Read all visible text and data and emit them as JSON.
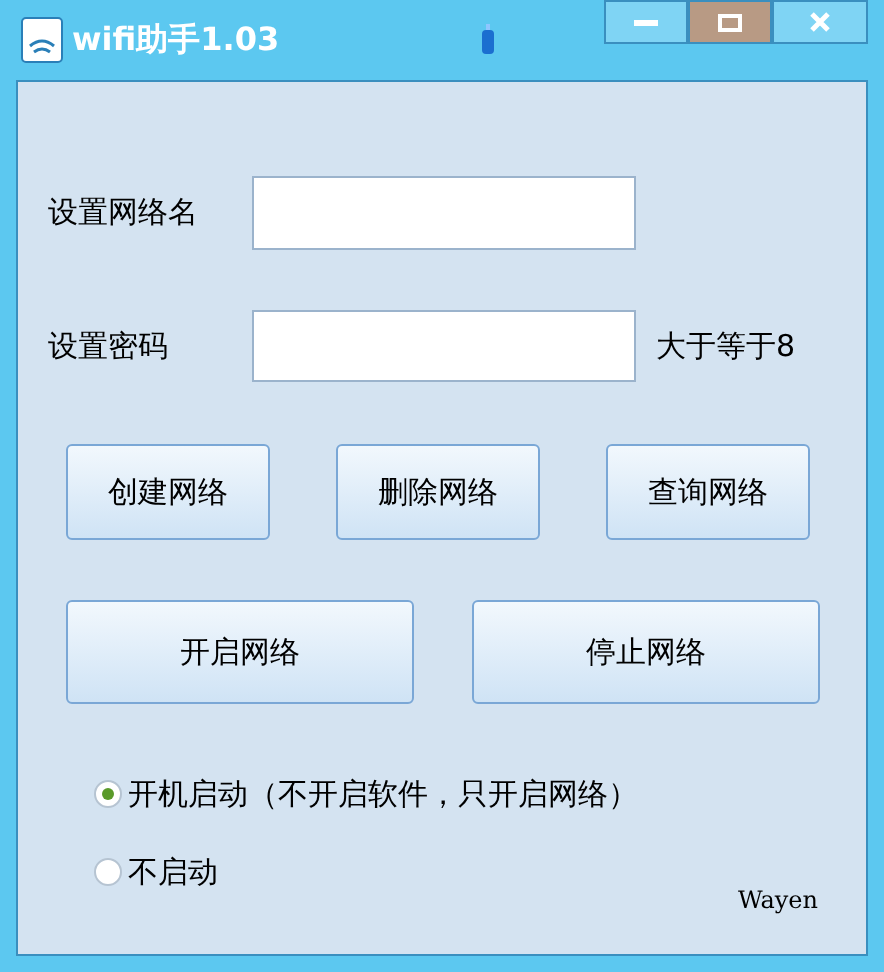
{
  "window": {
    "title": "wifi助手1.03"
  },
  "fields": [
    {
      "label": "设置网络名"
    },
    {
      "label": "设置密码",
      "hint": "大于等于8"
    }
  ],
  "buttons_row1": [
    "创建网络",
    "删除网络",
    "查询网络"
  ],
  "buttons_row2": [
    "开启网络",
    "停止网络"
  ],
  "radios": [
    {
      "label": "开机启动（不开启软件，只开启网络）",
      "selected": true
    },
    {
      "label": "不启动",
      "selected": false
    }
  ],
  "author": "Wayen"
}
